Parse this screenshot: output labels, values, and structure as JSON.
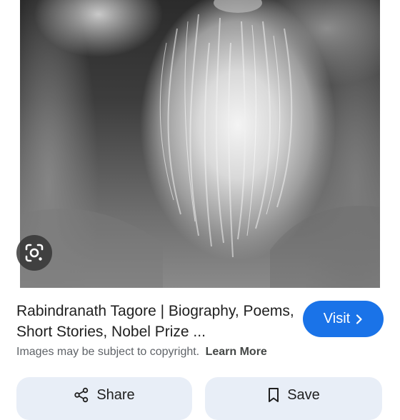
{
  "image": {
    "description_icon": "portrait-photo"
  },
  "lens_button": {
    "icon": "google-lens-icon"
  },
  "result": {
    "title": "Rabindranath Tagore | Biography, Poems, Short Stories, Nobel Prize ...",
    "visit_label": "Visit",
    "visit_icon": "chevron-right-icon",
    "copyright_text": "Images may be subject to copyright.",
    "learn_more_label": "Learn More"
  },
  "actions": {
    "share_label": "Share",
    "share_icon": "share-icon",
    "save_label": "Save",
    "save_icon": "bookmark-icon"
  },
  "colors": {
    "accent": "#1a73e8",
    "action_bg": "#e8eef7",
    "secondary_text": "#5f6368"
  }
}
